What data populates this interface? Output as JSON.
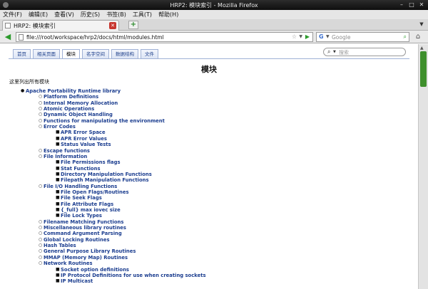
{
  "window": {
    "title": "HRP2: 模块索引 - Mozilla Firefox"
  },
  "menu": [
    "文件(F)",
    "编辑(E)",
    "查看(V)",
    "历史(S)",
    "书签(B)",
    "工具(T)",
    "帮助(H)"
  ],
  "tab": {
    "label": "HRP2: 模块索引"
  },
  "nav": {
    "url": "file:///root/workspace/hrp2/docs/html/modules.html",
    "search_placeholder": "Google"
  },
  "doc": {
    "tabs": [
      "首页",
      "相关页面",
      "模块",
      "名字空间",
      "数据结构",
      "文件"
    ],
    "active_tab": 2,
    "search_placeholder": "搜索",
    "title": "模块",
    "intro": "这里列出所有模块"
  },
  "tree": [
    {
      "label": "Apache Portability Runtime library",
      "level": 0
    },
    {
      "label": "Platform Definitions",
      "level": 1
    },
    {
      "label": "Internal Memory Allocation",
      "level": 1
    },
    {
      "label": "Atomic Operations",
      "level": 1
    },
    {
      "label": "Dynamic Object Handling",
      "level": 1
    },
    {
      "label": "Functions for manipulating the environment",
      "level": 1
    },
    {
      "label": "Error Codes",
      "level": 1
    },
    {
      "label": "APR Error Space",
      "level": 2
    },
    {
      "label": "APR Error Values",
      "level": 2
    },
    {
      "label": "Status Value Tests",
      "level": 2
    },
    {
      "label": "Escape functions",
      "level": 1
    },
    {
      "label": "File Information",
      "level": 1
    },
    {
      "label": "File Permissions flags",
      "level": 2
    },
    {
      "label": "Stat Functions",
      "level": 2
    },
    {
      "label": "Directory Manipulation Functions",
      "level": 2
    },
    {
      "label": "Filepath Manipulation Functions",
      "level": 2
    },
    {
      "label": "File I/O Handling Functions",
      "level": 1
    },
    {
      "label": "File Open Flags/Routines",
      "level": 2
    },
    {
      "label": "File Seek Flags",
      "level": 2
    },
    {
      "label": "File Attribute Flags",
      "level": 2
    },
    {
      "label": "{_full} max iovec size",
      "level": 2
    },
    {
      "label": "File Lock Types",
      "level": 2
    },
    {
      "label": "Filename Matching Functions",
      "level": 1
    },
    {
      "label": "Miscellaneous library routines",
      "level": 1
    },
    {
      "label": "Command Argument Parsing",
      "level": 1
    },
    {
      "label": "Global Locking Routines",
      "level": 1
    },
    {
      "label": "Hash Tables",
      "level": 1
    },
    {
      "label": "General Purpose Library Routines",
      "level": 1
    },
    {
      "label": "MMAP (Memory Map) Routines",
      "level": 1
    },
    {
      "label": "Network Routines",
      "level": 1
    },
    {
      "label": "Socket option definitions",
      "level": 2
    },
    {
      "label": "IP Protocol Definitions for use when creating sockets",
      "level": 2
    },
    {
      "label": "IP Multicast",
      "level": 2
    }
  ],
  "colors": {
    "link": "#1b3d8f",
    "scroll_thumb": "#3e8f2c",
    "tab_border": "#9fb1d6"
  }
}
